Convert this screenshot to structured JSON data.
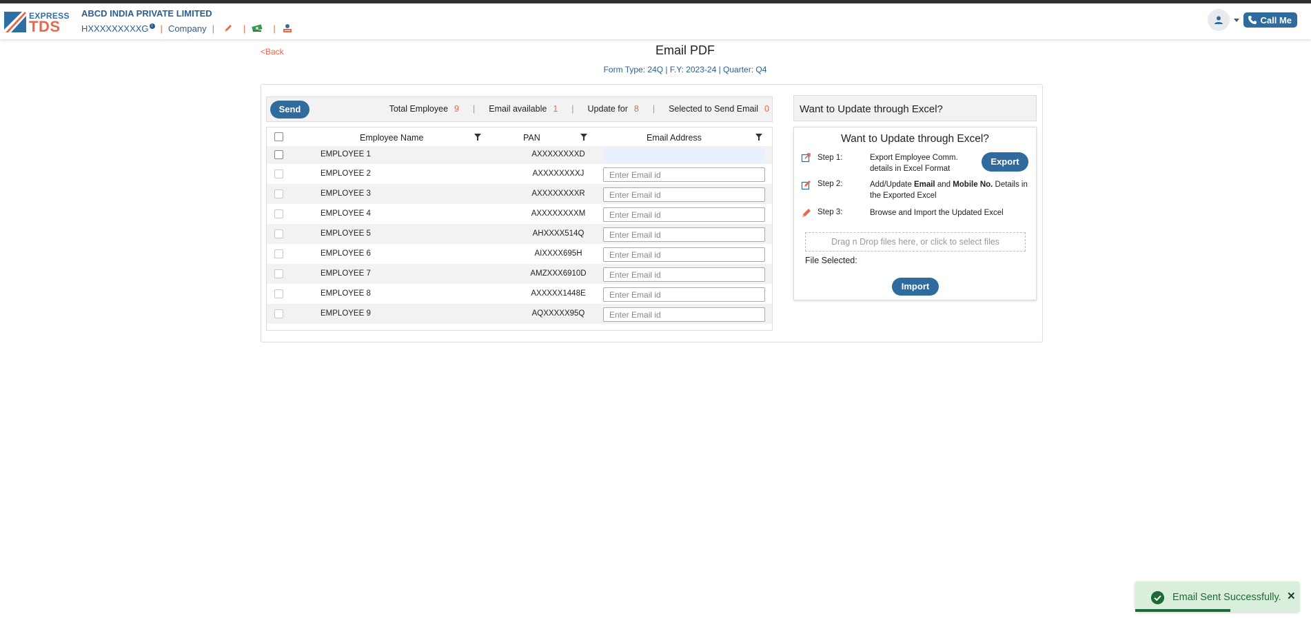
{
  "header": {
    "logo_express": "EXPRESS",
    "logo_tds": "TDS",
    "company_name": "ABCD INDIA PRIVATE LIMITED",
    "tan": "HXXXXXXXXXG",
    "tan_info_icon": "i",
    "sep": "|",
    "company_link": "Company",
    "call_me": "Call Me",
    "icons": [
      "pencil-icon",
      "money-icon",
      "form-icon",
      "user-icon",
      "phone-icon"
    ]
  },
  "page": {
    "back": "<Back",
    "title": "Email PDF",
    "form_info": "Form Type: 24Q | F.Y: 2023-24 | Quarter: Q4"
  },
  "toolbar": {
    "send": "Send",
    "total_employee_label": "Total Employee",
    "total_employee": "9",
    "email_available_label": "Email available",
    "email_available": "1",
    "update_for_label": "Update for",
    "update_for": "8",
    "selected_label": "Selected to Send Email",
    "selected": "0",
    "divider": "|"
  },
  "table": {
    "columns": [
      "Employee Name",
      "PAN",
      "Email Address"
    ],
    "email_placeholder": "Enter Email id",
    "rows": [
      {
        "name": "EMPLOYEE 1",
        "pan": "AXXXXXXXXD",
        "email": ""
      },
      {
        "name": "EMPLOYEE 2",
        "pan": "AXXXXXXXXJ",
        "email": ""
      },
      {
        "name": "EMPLOYEE 3",
        "pan": "AXXXXXXXXR",
        "email": ""
      },
      {
        "name": "EMPLOYEE 4",
        "pan": "AXXXXXXXXM",
        "email": ""
      },
      {
        "name": "EMPLOYEE 5",
        "pan": "AHXXXX514Q",
        "email": ""
      },
      {
        "name": "EMPLOYEE 6",
        "pan": "AIXXXX695H",
        "email": ""
      },
      {
        "name": "EMPLOYEE 7",
        "pan": "AMZXXX6910D",
        "email": ""
      },
      {
        "name": "EMPLOYEE 8",
        "pan": "AXXXXX1448E",
        "email": ""
      },
      {
        "name": "EMPLOYEE 9",
        "pan": "AQXXXXX95Q",
        "email": ""
      }
    ]
  },
  "excel": {
    "header": "Want to Update through Excel?",
    "card_title": "Want to Update through Excel?",
    "step1_label": "Step 1:",
    "step1_text_a": "Export Employee Comm.",
    "step1_text_b": "details in Excel Format",
    "export": "Export",
    "step2_label": "Step 2:",
    "step2_pre": "Add/Update ",
    "step2_email": "Email",
    "step2_and": " and ",
    "step2_mobile": "Mobile No.",
    "step2_post": " Details in",
    "step2_text_b": "the Exported Excel",
    "step3_label": "Step 3:",
    "step3_text": "Browse and Import the Updated Excel",
    "dropzone": "Drag n Drop files here, or click to select files",
    "file_selected": "File Selected:",
    "import": "Import"
  },
  "toast": {
    "message": "Email Sent Successfully.",
    "close": "✕"
  },
  "colors": {
    "primary": "#2f6b9c",
    "accent": "#e8674d",
    "success": "#1e6a36"
  }
}
